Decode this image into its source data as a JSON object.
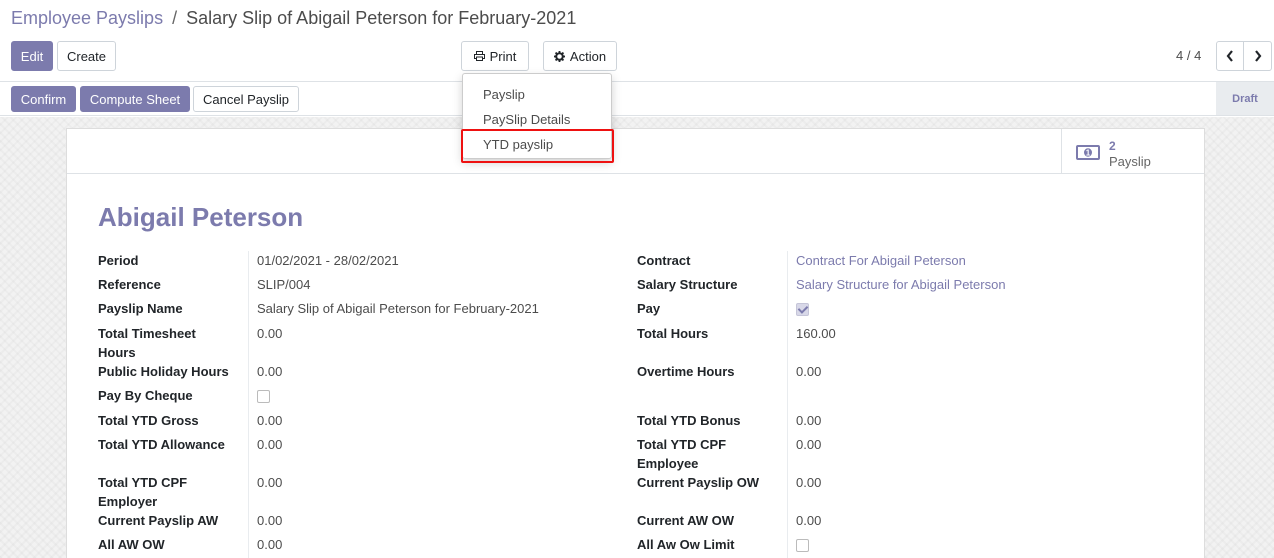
{
  "breadcrumb": {
    "parent": "Employee Payslips",
    "separator": "/",
    "current": "Salary Slip of Abigail Peterson for February-2021"
  },
  "toolbar": {
    "edit_label": "Edit",
    "create_label": "Create",
    "print_label": "Print",
    "action_label": "Action"
  },
  "pager": {
    "value": "4 / 4"
  },
  "print_menu": {
    "items": [
      "Payslip",
      "PaySlip Details",
      "YTD payslip"
    ]
  },
  "statusbar": {
    "confirm_label": "Confirm",
    "compute_label": "Compute Sheet",
    "cancel_label": "Cancel Payslip",
    "status": "Draft"
  },
  "smart_button": {
    "count": "2",
    "label": "Payslip"
  },
  "employee_name": "Abigail Peterson",
  "left_fields": [
    {
      "label": "Period",
      "value": "01/02/2021 - 28/02/2021"
    },
    {
      "label": "Reference",
      "value": "SLIP/004"
    },
    {
      "label": "Payslip Name",
      "value": "Salary Slip of Abigail Peterson for February-2021"
    },
    {
      "label": "Total Timesheet Hours",
      "value": "0.00"
    },
    {
      "label": "Public Holiday Hours",
      "value": "0.00"
    },
    {
      "label": "Pay By Cheque",
      "value": ""
    },
    {
      "label": "Total YTD Gross",
      "value": "0.00"
    },
    {
      "label": "Total YTD Allowance",
      "value": "0.00"
    },
    {
      "label": "Total YTD CPF Employer",
      "value": "0.00"
    },
    {
      "label": "Current Payslip AW",
      "value": "0.00"
    },
    {
      "label": "All AW OW",
      "value": "0.00"
    }
  ],
  "right_fields": [
    {
      "label": "Contract",
      "value": "Contract For Abigail Peterson"
    },
    {
      "label": "Salary Structure",
      "value": "Salary Structure for Abigail Peterson"
    },
    {
      "label": "Pay",
      "value": ""
    },
    {
      "label": "Total Hours",
      "value": "160.00"
    },
    {
      "label": "Overtime Hours",
      "value": "0.00"
    },
    {
      "label": "Total YTD Bonus",
      "value": "0.00"
    },
    {
      "label": "Total YTD CPF Employee",
      "value": "0.00"
    },
    {
      "label": "Current Payslip OW",
      "value": "0.00"
    },
    {
      "label": "Current AW OW",
      "value": "0.00"
    },
    {
      "label": "All Aw Ow Limit",
      "value": ""
    }
  ],
  "checkboxes": {
    "pay_by_cheque": false,
    "pay": true,
    "all_aw_ow_limit": false
  },
  "colors": {
    "accent": "#7c7bad",
    "highlight_border": "#ee1111"
  },
  "icons": {
    "print": "printer-icon",
    "action": "gear-icon",
    "prev": "chevron-left-icon",
    "next": "chevron-right-icon",
    "payslip_stat": "money-icon"
  }
}
